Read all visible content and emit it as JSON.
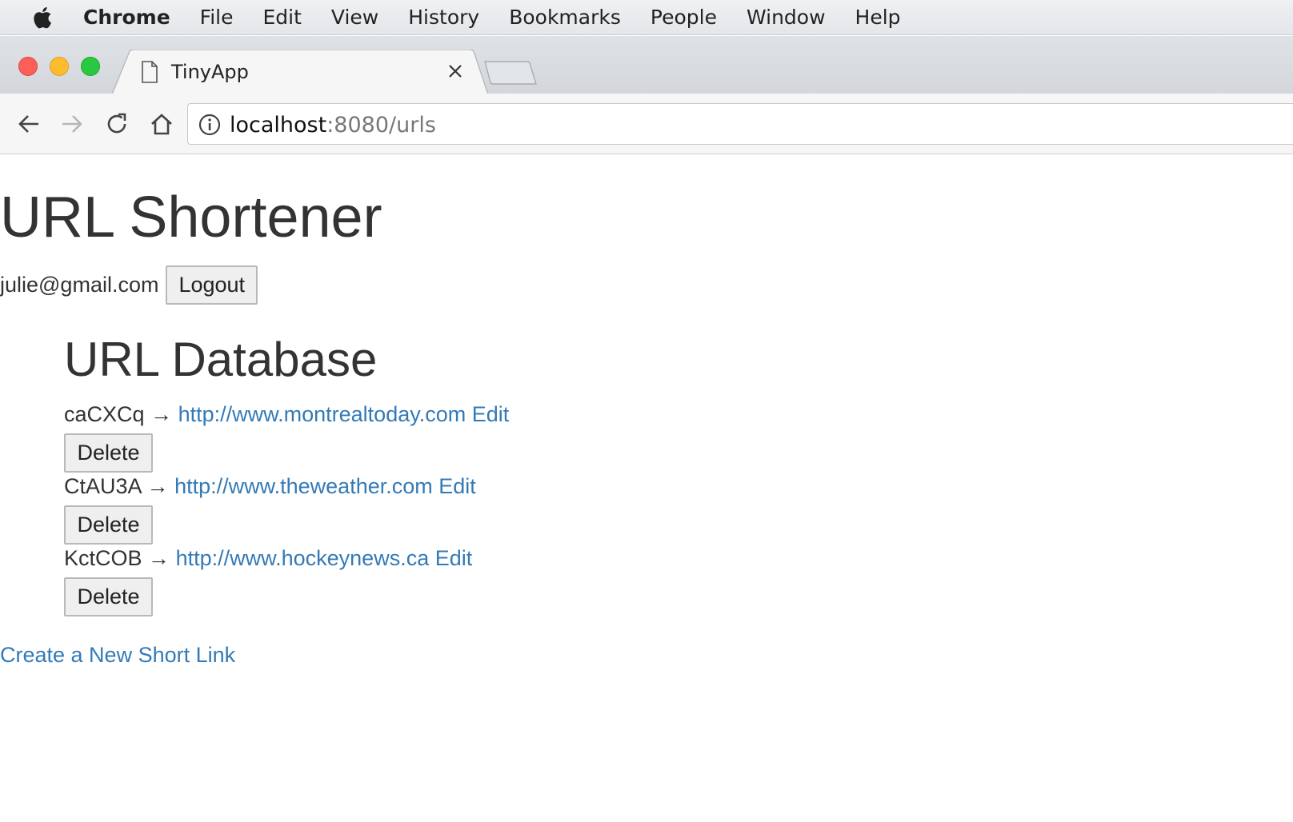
{
  "menubar": {
    "app_name": "Chrome",
    "items": [
      "File",
      "Edit",
      "View",
      "History",
      "Bookmarks",
      "People",
      "Window",
      "Help"
    ]
  },
  "tab": {
    "title": "TinyApp"
  },
  "omnibox": {
    "host": "localhost",
    "path": ":8080/urls"
  },
  "page": {
    "title": "URL Shortener",
    "user_email": "julie@gmail.com",
    "logout_label": "Logout",
    "db_heading": "URL Database",
    "arrow": "→",
    "edit_label": "Edit",
    "delete_label": "Delete",
    "entries": [
      {
        "short": "caCXCq",
        "long": "http://www.montrealtoday.com"
      },
      {
        "short": "CtAU3A",
        "long": "http://www.theweather.com"
      },
      {
        "short": "KctCOB",
        "long": "http://www.hockeynews.ca"
      }
    ],
    "create_link": "Create a New Short Link"
  },
  "colors": {
    "link": "#337ab7",
    "text": "#333333",
    "traffic_close": "#fc5f57",
    "traffic_min": "#fdbc2e",
    "traffic_max": "#29c840"
  }
}
